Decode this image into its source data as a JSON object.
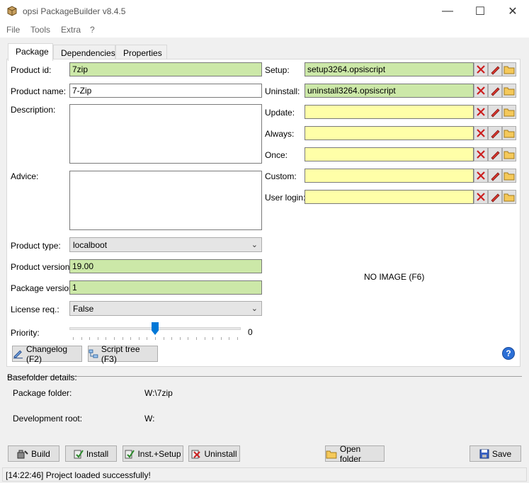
{
  "window": {
    "title": "opsi PackageBuilder v8.4.5",
    "minimize": "—",
    "maximize": "☐",
    "close": "✕"
  },
  "menu": [
    "File",
    "Tools",
    "Extra",
    "?"
  ],
  "tabs": [
    "Package",
    "Dependencies",
    "Properties"
  ],
  "left": {
    "product_id_label": "Product id:",
    "product_id": "7zip",
    "product_name_label": "Product name:",
    "product_name": "7-Zip",
    "description_label": "Description:",
    "advice_label": "Advice:",
    "product_type_label": "Product type:",
    "product_type": "localboot",
    "product_version_label": "Product version:",
    "product_version": "19.00",
    "package_version_label": "Package version:",
    "package_version": "1",
    "license_label": "License req.:",
    "license": "False",
    "priority_label": "Priority:",
    "priority": "0"
  },
  "scripts": [
    {
      "label": "Setup:",
      "value": "setup3264.opsiscript"
    },
    {
      "label": "Uninstall:",
      "value": "uninstall3264.opsiscript"
    },
    {
      "label": "Update:",
      "value": ""
    },
    {
      "label": "Always:",
      "value": ""
    },
    {
      "label": "Once:",
      "value": ""
    },
    {
      "label": "Custom:",
      "value": ""
    },
    {
      "label": "User login:",
      "value": ""
    }
  ],
  "no_image": "NO IMAGE (F6)",
  "buttons": {
    "changelog": "Changelog (F2)",
    "script_tree": "Script tree (F3)"
  },
  "basefolder": {
    "heading": "Basefolder details:",
    "package_folder_label": "Package folder:",
    "package_folder": "W:\\7zip",
    "dev_root_label": "Development root:",
    "dev_root": "W:"
  },
  "bottom": {
    "build": "Build",
    "install": "Install",
    "inst_setup": "Inst.+Setup",
    "uninstall": "Uninstall",
    "open_folder": "Open folder",
    "save": "Save"
  },
  "status": "[14:22:46] Project loaded successfully!",
  "colors": {
    "green_field": "#cce8a8",
    "yellow_field": "#ffffa8",
    "accent": "#0078d7"
  }
}
